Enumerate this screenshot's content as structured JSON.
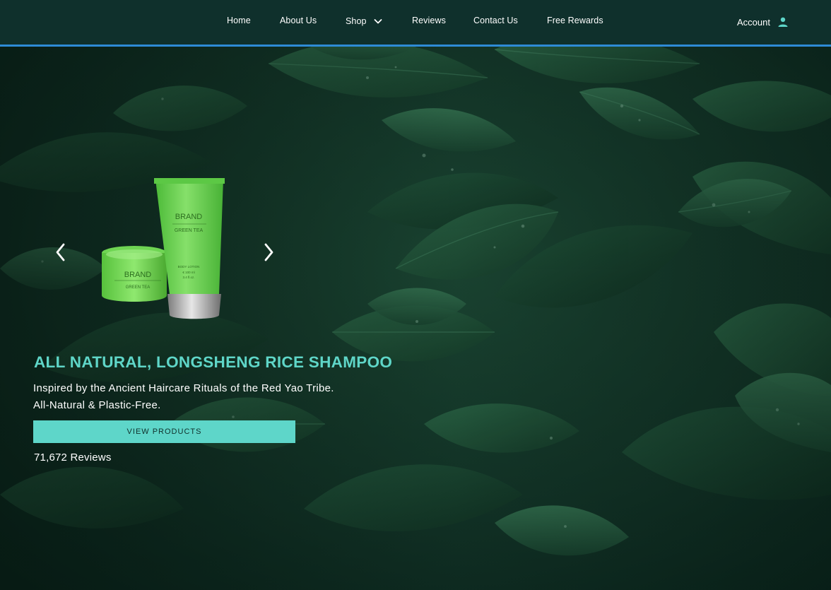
{
  "nav": {
    "items": [
      {
        "label": "Home"
      },
      {
        "label": "About Us"
      },
      {
        "label": "Shop"
      },
      {
        "label": "Reviews"
      },
      {
        "label": "Contact Us"
      },
      {
        "label": "Free Rewards"
      }
    ],
    "shop_icon": "chevron-down-icon",
    "account_label": "Account",
    "account_icon": "user-icon"
  },
  "carousel": {
    "prev_icon": "chevron-left-icon",
    "next_icon": "chevron-right-icon",
    "product": {
      "tube_brand": "BRAND",
      "tube_line": "GREEN TEA",
      "tube_type": "BODY LOTION",
      "tube_volume_1": "€ 100 ml",
      "tube_volume_2": "3.4 fl.oz.",
      "jar_brand": "BRAND",
      "jar_line": "GREEN TEA"
    }
  },
  "hero": {
    "title": "ALL NATURAL, LONGSHENG RICE SHAMPOO",
    "subtitle_line1": "Inspired by the Ancient Haircare Rituals of the Red Yao Tribe.",
    "subtitle_line2": "All-Natural & Plastic-Free.",
    "cta_label": "VIEW PRODUCTS",
    "reviews": "71,672 Reviews"
  },
  "colors": {
    "header_bg": "#0f302c",
    "header_border": "#2e8bd6",
    "accent_teal": "#5ed6c9",
    "title_teal": "#5fd6c8",
    "hero_bg": "#0b2a20"
  }
}
